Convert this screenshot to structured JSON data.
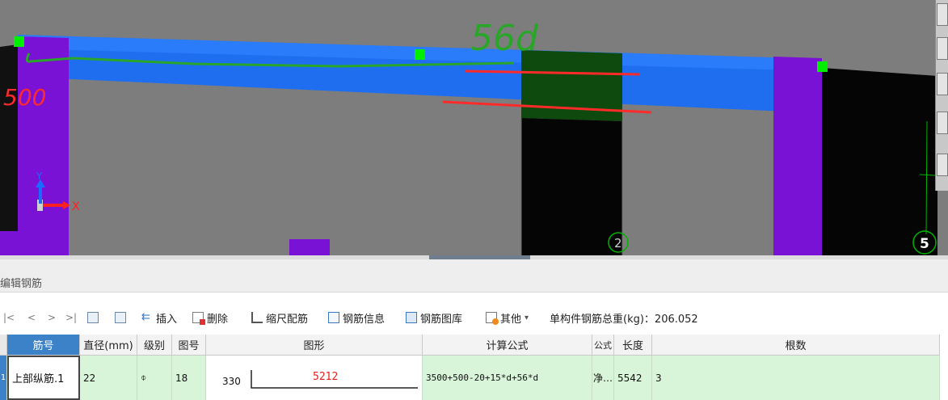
{
  "viewport": {
    "axis_y": "Y",
    "axis_x": "X",
    "axis_ids": [
      "2",
      "5"
    ],
    "annotations": [
      "56d",
      "500"
    ]
  },
  "panel": {
    "title": "编辑钢筋"
  },
  "toolbar": {
    "nav_first": "|<",
    "nav_prev": "<",
    "nav_next": ">",
    "nav_last": ">|",
    "insert_label": "插入",
    "delete_label": "删除",
    "scale_label": "缩尺配筋",
    "info_label": "钢筋信息",
    "library_label": "钢筋图库",
    "other_label": "其他",
    "other_caret": "▾",
    "total_weight": "单构件钢筋总重(kg)：206.052"
  },
  "table": {
    "headers": [
      "筋号",
      "直径(mm)",
      "级别",
      "图号",
      "图形",
      "计算公式",
      "公式",
      "长度",
      "根数"
    ],
    "rows": [
      {
        "row_no": "1",
        "name": "上部纵筋.1",
        "diameter": "22",
        "grade": "⌽",
        "figure_no": "18",
        "shape_left": "330",
        "shape_length": "5212",
        "formula": "3500+500-20+15*d+56*d",
        "formula_desc": "净…",
        "length": "5542",
        "count": "3"
      }
    ]
  },
  "colors": {
    "beam_blue": "#1f6ef0",
    "column_purple": "#7a12d6",
    "selected_green": "#0e4a0e",
    "row_green": "#d9f5d9",
    "header_selected": "#3c82c8"
  }
}
